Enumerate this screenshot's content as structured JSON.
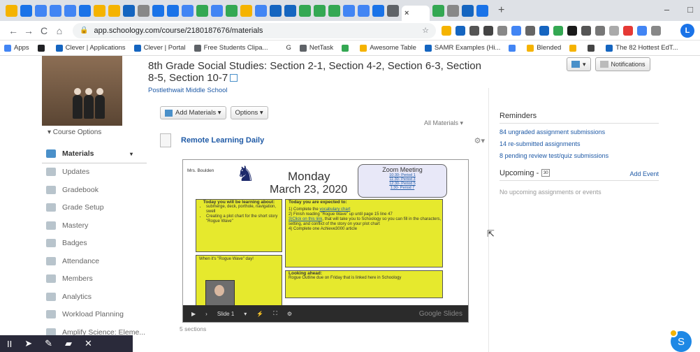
{
  "browser": {
    "tabs": [
      {
        "icon": "schoology-tab-icon",
        "color": "#f5b300"
      },
      {
        "icon": "classlink-tab-icon",
        "color": "#1a73e8"
      },
      {
        "icon": "docs-tab-icon",
        "color": "#4285f4"
      },
      {
        "icon": "docs-tab-icon",
        "color": "#4285f4"
      },
      {
        "icon": "docs-tab-icon",
        "color": "#4285f4"
      },
      {
        "icon": "classlink-tab-icon",
        "color": "#1a73e8"
      },
      {
        "icon": "slides-tab-icon",
        "color": "#f5b300"
      },
      {
        "icon": "slides-tab-icon",
        "color": "#f5b300"
      },
      {
        "icon": "schoology-tab-icon",
        "color": "#1565c0"
      },
      {
        "icon": "ne-tab-icon",
        "color": "#888888"
      },
      {
        "icon": "classlink-tab-icon",
        "color": "#1a73e8"
      },
      {
        "icon": "classlink-tab-icon",
        "color": "#1a73e8"
      },
      {
        "icon": "docs-tab-icon",
        "color": "#4285f4"
      },
      {
        "icon": "drive-tab-icon",
        "color": "#34a853"
      },
      {
        "icon": "docs-tab-icon",
        "color": "#4285f4"
      },
      {
        "icon": "drive-tab-icon",
        "color": "#34a853"
      },
      {
        "icon": "slides-tab-icon",
        "color": "#f5b300"
      },
      {
        "icon": "docs-tab-icon",
        "color": "#4285f4"
      },
      {
        "icon": "clever-tab-icon",
        "color": "#1565c0"
      },
      {
        "icon": "clever-tab-icon",
        "color": "#1565c0"
      },
      {
        "icon": "drive-tab-icon",
        "color": "#34a853"
      },
      {
        "icon": "drive-tab-icon",
        "color": "#34a853"
      },
      {
        "icon": "drive-tab-icon",
        "color": "#34a853"
      },
      {
        "icon": "docs-tab-icon",
        "color": "#4285f4"
      },
      {
        "icon": "docs-tab-icon",
        "color": "#4285f4"
      },
      {
        "icon": "classlink-tab-icon",
        "color": "#1a73e8"
      },
      {
        "icon": "circle-tab-icon",
        "color": "#5f6368"
      }
    ],
    "active_tab_close": "×",
    "after_tabs": [
      {
        "icon": "drive-tab-icon",
        "color": "#34a853"
      },
      {
        "icon": "ne-tab-icon",
        "color": "#888888"
      },
      {
        "icon": "clever-tab-icon",
        "color": "#1565c0"
      },
      {
        "icon": "classlink-tab-icon",
        "color": "#1a73e8"
      }
    ],
    "new_tab": "+",
    "minimize": "–",
    "maximize": "□",
    "back": "←",
    "forward": "→",
    "reload": "C",
    "home": "⌂",
    "url": "app.schoology.com/course/2180187676/materials",
    "star": "☆",
    "profile_initial": "L",
    "extension_colors": [
      "#f5b300",
      "#1565c0",
      "#555555",
      "#444444",
      "#888888",
      "#4285f4",
      "#666666",
      "#1565c0",
      "#34a853",
      "#1a1a1a",
      "#555555",
      "#777777",
      "#aaaaaa",
      "#e53935",
      "#4285f4",
      "#888888"
    ],
    "bookmarks": [
      {
        "label": "Apps",
        "color": "#4285f4"
      },
      {
        "label": "",
        "color": "#202124"
      },
      {
        "label": "Clever | Applications",
        "color": "#1565c0"
      },
      {
        "label": "Clever | Portal",
        "color": "#1565c0"
      },
      {
        "label": "Free Students Clipa...",
        "color": "#5f6368"
      },
      {
        "label": "G",
        "color": "#ffffff"
      },
      {
        "label": "NetTask",
        "color": "#5f6368"
      },
      {
        "label": "",
        "color": "#34a853"
      },
      {
        "label": "Awesome Table",
        "color": "#f5b300"
      },
      {
        "label": "SAMR Examples (Hi...",
        "color": "#1565c0"
      },
      {
        "label": "",
        "color": "#4285f4"
      },
      {
        "label": "Blended",
        "color": "#f5b300"
      },
      {
        "label": "",
        "color": "#f5b300"
      },
      {
        "label": "",
        "color": "#444444"
      },
      {
        "label": "The 82 Hottest EdT...",
        "color": "#1565c0"
      }
    ]
  },
  "course": {
    "title": "8th Grade Social Studies: Section 2-1, Section 4-2, Section 6-3, Section 8-5, Section 10-7",
    "school": "Postlethwait Middle School",
    "options_label": "▾ Course Options"
  },
  "nav": [
    {
      "label": "Materials",
      "active": true,
      "icon": "materials-icon"
    },
    {
      "label": "Updates",
      "icon": "updates-icon"
    },
    {
      "label": "Gradebook",
      "icon": "gradebook-icon"
    },
    {
      "label": "Grade Setup",
      "icon": "grade-setup-icon"
    },
    {
      "label": "Mastery",
      "icon": "mastery-icon"
    },
    {
      "label": "Badges",
      "icon": "badges-icon"
    },
    {
      "label": "Attendance",
      "icon": "attendance-icon"
    },
    {
      "label": "Members",
      "icon": "members-icon"
    },
    {
      "label": "Analytics",
      "icon": "analytics-icon"
    },
    {
      "label": "Workload Planning",
      "icon": "workload-icon"
    },
    {
      "label": "Amplify Science: Eleme...",
      "icon": "amplify-icon"
    }
  ],
  "materials": {
    "add_label": "Add Materials ▾",
    "options_label": "Options ▾",
    "all_materials": "All Materials ▾",
    "item_title": "Remote Learning Daily",
    "gear": "⚙▾",
    "sections_count": "5 sections"
  },
  "slide": {
    "teacher": "Mrs. Boulden",
    "day": "Monday",
    "date": "March 23, 2020",
    "zoom_title": "Zoom Meeting",
    "zoom_links": [
      "10:30- Period 1",
      "11:30- Period 3",
      "12:30- Period 5",
      "1:30- Period 7"
    ],
    "learning_head": "Today you will be learning about:",
    "learning_items": [
      "submerge, deck, porthole, navigation, swell",
      "Creating a plot chart for the short story \"Rogue Wave\""
    ],
    "expected_head": "Today you are expected to:",
    "expected_1a": "1) Complete the ",
    "expected_1b": "vocabulary chart",
    "expected_2": "2) Finish reading \"Rogue Wave\" up until page 15 line 47",
    "expected_3a": "3)Click on this link",
    "expected_3b": ", that will take you to Schoology so you can fill in the characters, setting, and conflict of the story on your plot chart",
    "expected_4": "4) Complete one Achieve3000 article",
    "rogue_day": "When it's \"Rogue Wave\" day!",
    "looking_head": "Looking ahead:",
    "looking_text": "Rogue Outline due on Friday that is linked here in Schoology",
    "slide_label": "Slide 1",
    "google_slides": "Google Slides"
  },
  "right": {
    "notifications": "Notifications",
    "reminders_head": "Reminders",
    "reminders": [
      "84 ungraded assignment submissions",
      "14 re-submitted assignments",
      "8 pending review test/quiz submissions"
    ],
    "upcoming_head": "Upcoming -",
    "calendar_num": "30",
    "add_event": "Add Event",
    "no_upcoming": "No upcoming assignments or events"
  },
  "overlay": {
    "pause": "II",
    "pointer": "➤",
    "pen": "✎",
    "marker": "▰",
    "close": "✕",
    "user_initial": "S"
  }
}
